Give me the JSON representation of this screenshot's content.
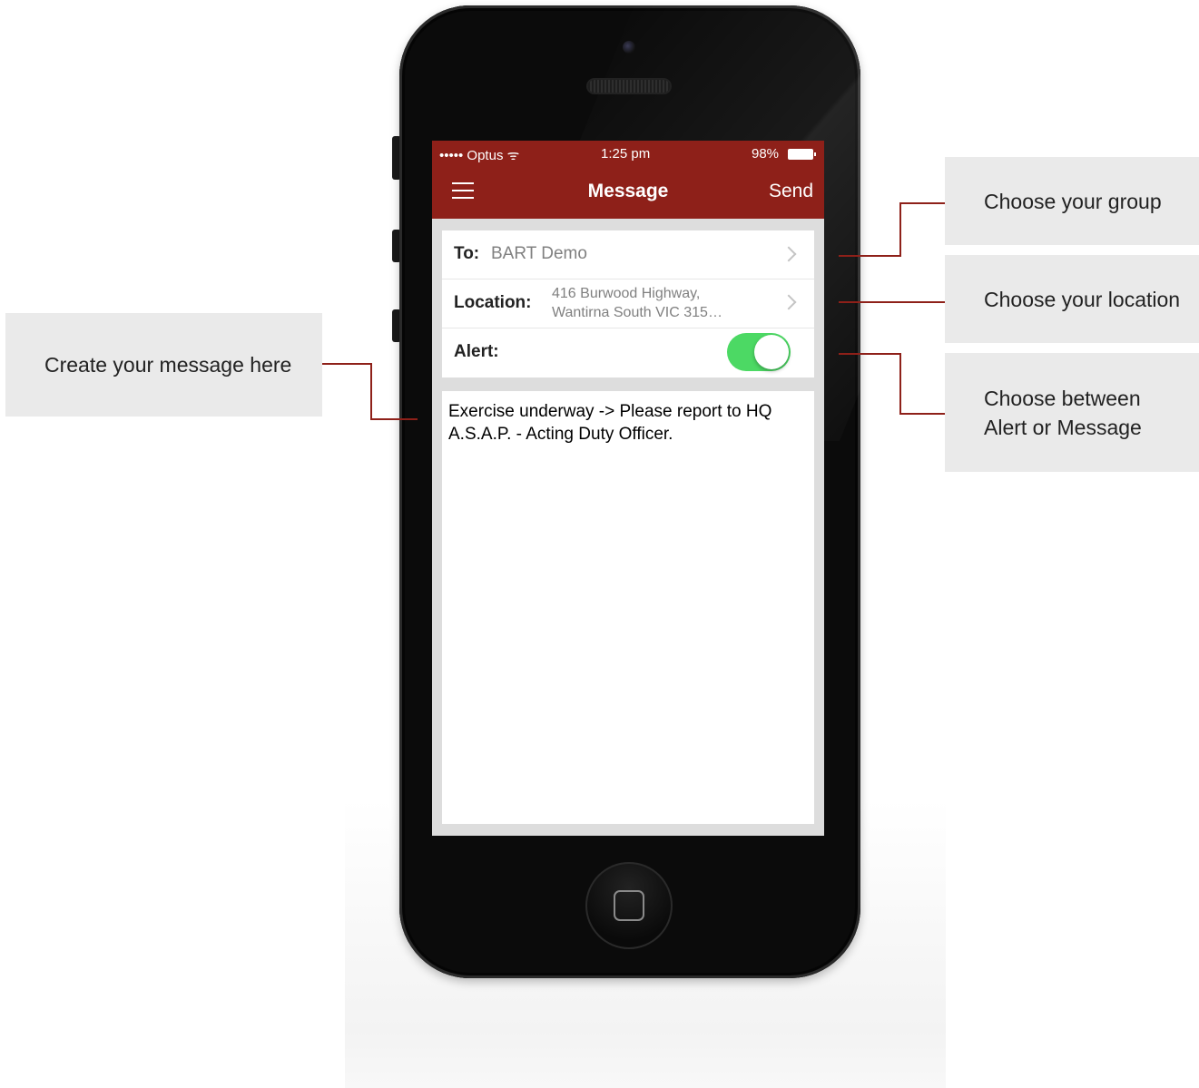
{
  "status_bar": {
    "carrier": "••••• Optus ᯤ",
    "time": "1:25 pm",
    "battery": "98%"
  },
  "nav": {
    "title": "Message",
    "send_label": "Send"
  },
  "form": {
    "to_label": "To:",
    "to_value": "BART Demo",
    "location_label": "Location:",
    "location_line1": "416 Burwood Highway,",
    "location_line2": "Wantirna South VIC 315…",
    "alert_label": "Alert:",
    "alert_on": true
  },
  "message": {
    "text": "Exercise underway -> Please report to HQ A.S.A.P. - Acting Duty Officer."
  },
  "callouts": {
    "group": "Choose your group",
    "location": "Choose your location",
    "alert_line1": "Choose between",
    "alert_line2": "Alert or Message",
    "message": "Create your message here"
  },
  "colors": {
    "brand": "#8e2019",
    "toggle_on": "#4cd964"
  }
}
